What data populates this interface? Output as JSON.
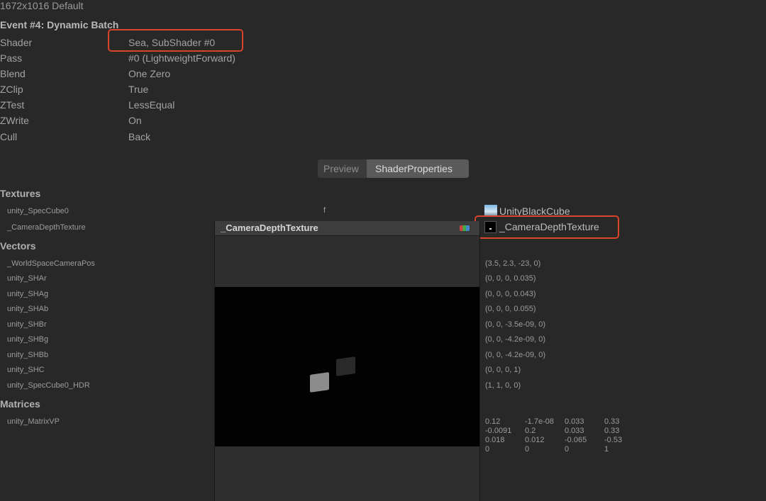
{
  "header": {
    "resolution": "1672x1016 Default",
    "event": "Event #4: Dynamic Batch"
  },
  "properties": [
    {
      "label": "Shader",
      "value": "Sea, SubShader #0"
    },
    {
      "label": "Pass",
      "value": "#0 (LightweightForward)"
    },
    {
      "label": "Blend",
      "value": "One Zero"
    },
    {
      "label": "ZClip",
      "value": "True"
    },
    {
      "label": "ZTest",
      "value": "LessEqual"
    },
    {
      "label": "ZWrite",
      "value": "On"
    },
    {
      "label": "Cull",
      "value": "Back"
    }
  ],
  "tabs": {
    "preview": "Preview",
    "shader_properties": "ShaderProperties"
  },
  "textures": {
    "section": "Textures",
    "items": [
      {
        "name": "unity_SpecCube0",
        "stage": "f",
        "value": "UnityBlackCube",
        "icon": "cubemap-icon"
      },
      {
        "name": "_CameraDepthTexture",
        "value": "_CameraDepthTexture",
        "icon": "texture-icon"
      }
    ]
  },
  "vectors": {
    "section": "Vectors",
    "items": [
      {
        "name": "_WorldSpaceCameraPos",
        "value": "(3.5, 2.3, -23, 0)"
      },
      {
        "name": "unity_SHAr",
        "value": "(0, 0, 0, 0.035)"
      },
      {
        "name": "unity_SHAg",
        "value": "(0, 0, 0, 0.043)"
      },
      {
        "name": "unity_SHAb",
        "value": "(0, 0, 0, 0.055)"
      },
      {
        "name": "unity_SHBr",
        "value": "(0, 0, -3.5e-09, 0)"
      },
      {
        "name": "unity_SHBg",
        "value": "(0, 0, -4.2e-09, 0)"
      },
      {
        "name": "unity_SHBb",
        "value": "(0, 0, -4.2e-09, 0)"
      },
      {
        "name": "unity_SHC",
        "value": "(0, 0, 0, 1)"
      },
      {
        "name": "unity_SpecCube0_HDR",
        "value": "(1, 1, 0, 0)"
      }
    ]
  },
  "matrices": {
    "section": "Matrices",
    "items": [
      {
        "name": "unity_MatrixVP",
        "rows": [
          [
            "0.12",
            "-1.7e-08",
            "0.033",
            "0.33"
          ],
          [
            "-0.0091",
            "0.2",
            "0.033",
            "0.33"
          ],
          [
            "0.018",
            "0.012",
            "-0.065",
            "-0.53"
          ],
          [
            "0",
            "0",
            "0",
            "1"
          ]
        ]
      }
    ]
  },
  "popup": {
    "title": "_CameraDepthTexture"
  },
  "colors": {
    "highlight": "#d8432a",
    "background": "#282828"
  }
}
